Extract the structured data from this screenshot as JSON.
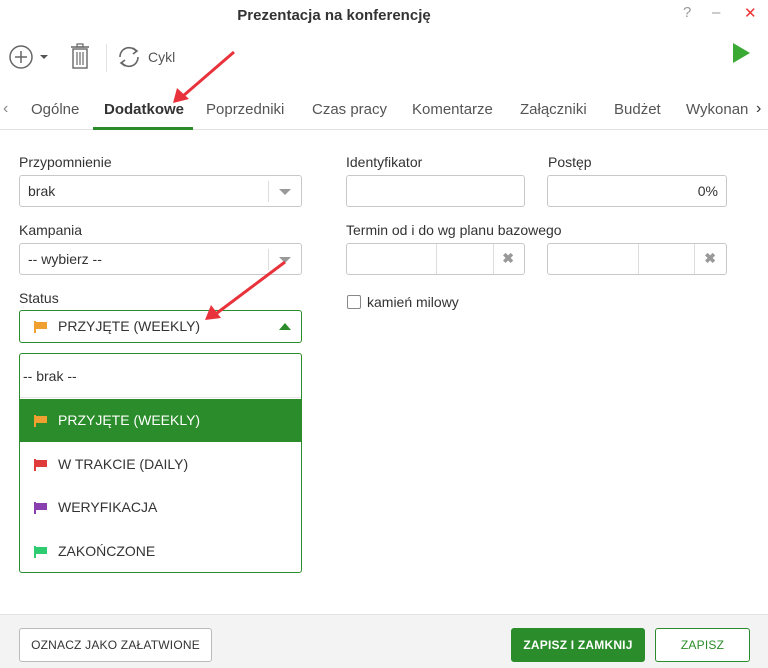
{
  "window": {
    "title": "Prezentacja na konferencję",
    "help": "?",
    "minimize": "–",
    "close": "✕"
  },
  "toolbar": {
    "cycle_label": "Cykl"
  },
  "tabs": [
    {
      "label": "Ogólne"
    },
    {
      "label": "Dodatkowe"
    },
    {
      "label": "Poprzedniki"
    },
    {
      "label": "Czas pracy"
    },
    {
      "label": "Komentarze"
    },
    {
      "label": "Załączniki"
    },
    {
      "label": "Budżet"
    },
    {
      "label": "Wykonan"
    }
  ],
  "active_tab": "Dodatkowe",
  "form": {
    "reminder_label": "Przypomnienie",
    "reminder_value": "brak",
    "campaign_label": "Kampania",
    "campaign_value": "-- wybierz --",
    "status_label": "Status",
    "status_value": "PRZYJĘTE (WEEKLY)",
    "identifier_label": "Identyfikator",
    "identifier_value": "",
    "progress_label": "Postęp",
    "progress_value": "0%",
    "term_label": "Termin od i do wg planu bazowego",
    "milestone_label": "kamień milowy"
  },
  "status_dropdown": {
    "search_value": "-- brak --",
    "options": [
      {
        "label": "PRZYJĘTE (WEEKLY)",
        "flag_color": "#f0a030",
        "selected": true
      },
      {
        "label": "W TRAKCIE (DAILY)",
        "flag_color": "#e03b3b",
        "selected": false
      },
      {
        "label": "WERYFIKACJA",
        "flag_color": "#8a3fb0",
        "selected": false
      },
      {
        "label": "ZAKOŃCZONE",
        "flag_color": "#2ecc71",
        "selected": false
      }
    ]
  },
  "footer": {
    "mark_resolved": "OZNACZ JAKO ZAŁATWIONE",
    "save_close": "ZAPISZ I ZAMKNIJ",
    "save": "ZAPISZ"
  },
  "colors": {
    "accent": "#2a8c2a",
    "annotation_arrow": "#e8333c",
    "play": "#3aaa35"
  }
}
